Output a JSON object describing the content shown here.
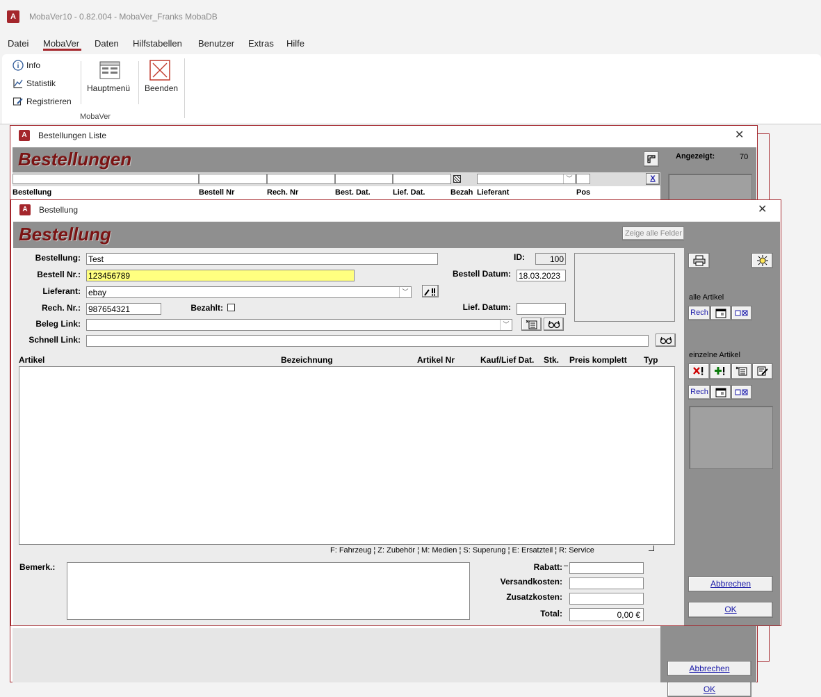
{
  "app": {
    "title": "MobaVer10 - 0.82.004 - MobaVer_Franks MobaDB",
    "logo": "A"
  },
  "menu": {
    "items": [
      "Datei",
      "MobaVer",
      "Daten",
      "Hilfstabellen",
      "Benutzer",
      "Extras",
      "Hilfe"
    ],
    "active": "MobaVer"
  },
  "ribbon": {
    "info": "Info",
    "statistik": "Statistik",
    "registrieren": "Registrieren",
    "hauptmenu": "Hauptmenü",
    "beenden": "Beenden",
    "group_label": "MobaVer"
  },
  "list_window": {
    "title": "Bestellungen Liste",
    "heading": "Bestellungen",
    "angezeigt_label": "Angezeigt:",
    "angezeigt_value": "70",
    "clear_filter": "X",
    "columns": [
      "Bestellung",
      "Bestell Nr",
      "Rech. Nr",
      "Best. Dat.",
      "Lief. Dat.",
      "Bezah",
      "Lieferant",
      "Pos"
    ],
    "cancel": "Abbrechen",
    "ok": "OK"
  },
  "form": {
    "title": "Bestellung",
    "heading": "Bestellung",
    "show_all": "Zeige alle Felder",
    "labels": {
      "bestellung": "Bestellung:",
      "bestell_nr": "Bestell Nr.:",
      "lieferant": "Lieferant:",
      "rech_nr": "Rech. Nr.:",
      "bezahlt": "Bezahlt:",
      "beleg_link": "Beleg Link:",
      "schnell_link": "Schnell Link:",
      "id": "ID:",
      "bestell_datum": "Bestell Datum:",
      "lief_datum": "Lief. Datum:",
      "bemerk": "Bemerk.:",
      "rabatt": "Rabatt:",
      "versandkosten": "Versandkosten:",
      "zusatzkosten": "Zusatzkosten:",
      "total": "Total:"
    },
    "values": {
      "bestellung": "Test",
      "bestell_nr": "123456789",
      "lieferant": "ebay",
      "rech_nr": "987654321",
      "beleg_link": "",
      "schnell_link": "",
      "id": "100",
      "bestell_datum": "18.03.2023",
      "lief_datum": "",
      "rabatt": "",
      "versandkosten": "",
      "zusatzkosten": "",
      "total": "0,00 €"
    },
    "columns": [
      "Artikel",
      "Bezeichnung",
      "Artikel Nr",
      "Kauf/Lief Dat.",
      "Stk.",
      "Preis komplett",
      "Typ"
    ],
    "legend": "F: Fahrzeug ¦ Z: Zubehör ¦ M: Medien ¦ S: Superung ¦ E: Ersatzteil ¦ R: Service",
    "side": {
      "alle_artikel": "alle Artikel",
      "einzelne_artikel": "einzelne Artikel",
      "rech": "Rech",
      "cancel": "Abbrechen",
      "ok": "OK"
    }
  },
  "colors": {
    "accent": "#a4262c",
    "header_grey": "#8f8f8f",
    "title_red": "#7a1313",
    "highlight_yellow": "#ffff80"
  }
}
